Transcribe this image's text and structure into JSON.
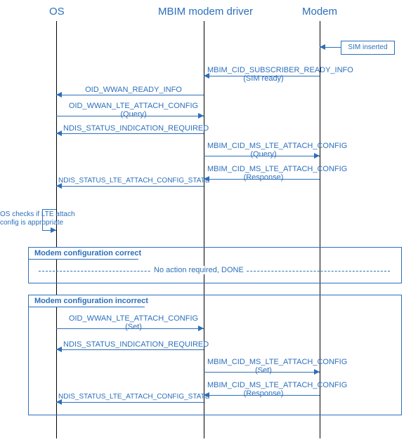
{
  "diagram": {
    "actors": {
      "os": "OS",
      "driver": "MBIM modem driver",
      "modem": "Modem"
    },
    "lifeline_x": {
      "os": 80,
      "driver": 290,
      "modem": 455
    },
    "notes": {
      "sim_inserted": "SIM inserted",
      "os_check_l1": "OS checks if LTE attach",
      "os_check_l2": "config is appropriate"
    },
    "frames": {
      "correct_label": "Modem configuration correct",
      "correct_body": "No action required, DONE",
      "incorrect_label": "Modem configuration incorrect"
    },
    "messages": {
      "m1_l1": "MBIM_CID_SUBSCRIBER_READY_INFO",
      "m1_l2": "(SIM ready)",
      "m2_l1": "OID_WWAN_READY_INFO",
      "m3_l1": "OID_WWAN_LTE_ATTACH_CONFIG",
      "m3_l2": "(Query)",
      "m4_l1": "NDIS_STATUS_INDICATION_REQUIRED",
      "m5_l1": "MBIM_CID_MS_LTE_ATTACH_CONFIG",
      "m5_l2": "(Query)",
      "m6_l1": "MBIM_CID_MS_LTE_ATTACH_CONFIG",
      "m6_l2": "(Response)",
      "m7_l1": "NDIS_STATUS_LTE_ATTACH_CONFIG_STATE",
      "m8_l1": "OID_WWAN_LTE_ATTACH_CONFIG",
      "m8_l2": "(Set)",
      "m9_l1": "NDIS_STATUS_INDICATION_REQUIRED",
      "m10_l1": "MBIM_CID_MS_LTE_ATTACH_CONFIG",
      "m10_l2": "(Set)",
      "m11_l1": "MBIM_CID_MS_LTE_ATTACH_CONFIG",
      "m11_l2": "(Response)",
      "m12_l1": "NDIS_STATUS_LTE_ATTACH_CONFIG_STATE"
    }
  }
}
